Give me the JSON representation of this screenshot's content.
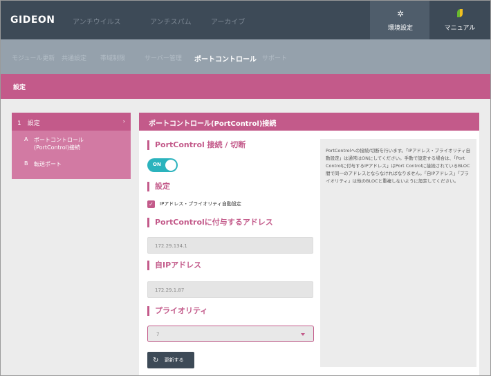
{
  "topnav": {
    "logo": "GIDEON",
    "links": [
      "アンチウイルス",
      "アンチスパム",
      "アーカイブ"
    ],
    "env_label": "環境設定",
    "manual_label": "マニュアル"
  },
  "subnav": {
    "links": [
      "モジュール更新",
      "共通設定",
      "帯域制限",
      "サーバー管理",
      "ポートコントロール",
      "サポート"
    ],
    "active_index": 4
  },
  "pinkbar": {
    "title": "設定"
  },
  "sidebar": {
    "head": "1　設定",
    "head_arrow": "›",
    "items": [
      {
        "mark": "A",
        "label_line1": "ポートコントロール",
        "label_line2": "(PortControl)接続"
      },
      {
        "mark": "B",
        "label_line1": "転送ポート",
        "label_line2": ""
      }
    ]
  },
  "main": {
    "header": "ポートコントロール(PortControl)接続",
    "section_connect": "PortControl 接続 / 切断",
    "toggle_label": "ON",
    "section_settings": "設定",
    "checkbox_label": "IPアドレス・プライオリティ自動設定",
    "section_address": "PortControlに付与するアドレス",
    "address_value": "172.29.134.1",
    "section_own_ip": "自IPアドレス",
    "own_ip_value": "172.29.1.87",
    "section_priority": "プライオリティ",
    "priority_value": "7",
    "update_label": "更新する"
  },
  "help": {
    "text": "PortControlへの接続/切断を行います。「IPアドレス・プライオリティ自動設定」は通常はONにしてください。手動で設定する場合は、「Port Controlに付与するIPアドレス」はPort Controlに接続されているBLOC間で同一のアドレスとならなければなりません。「自IPアドレス」「プライオリティ」は他のBLOCと重複しないように設定してください。"
  },
  "colors": {
    "nav_dark": "#3d4a57",
    "subnav": "#95a1ac",
    "accent_pink": "#c35a8a",
    "toggle_teal": "#2bb3bd"
  }
}
